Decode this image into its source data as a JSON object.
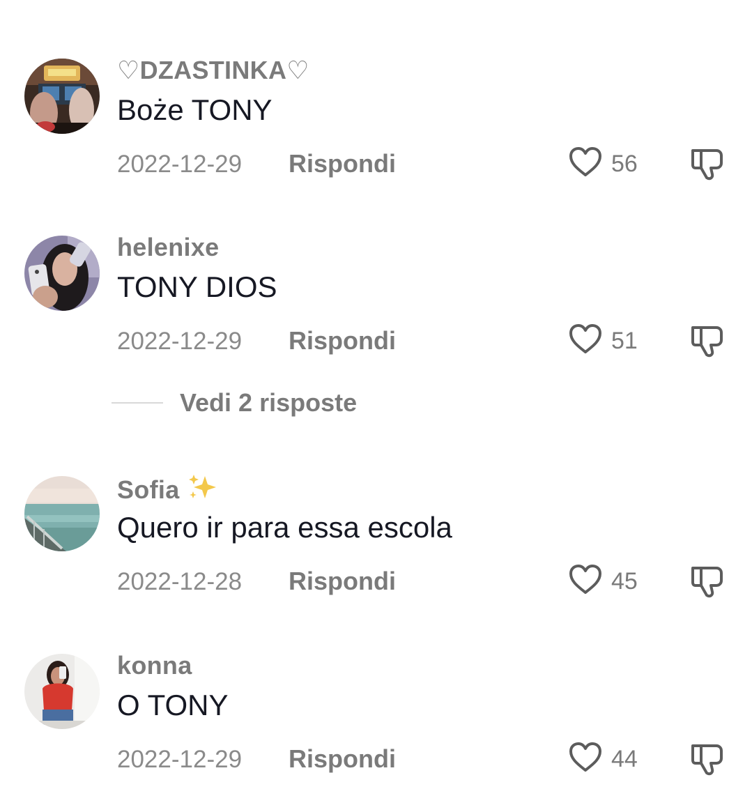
{
  "comments": [
    {
      "username": "♡DZASTINKA♡",
      "text": "Boże TONY",
      "date": "2022-12-29",
      "reply_label": "Rispondi",
      "likes": "56",
      "avatar": "arcade-photo"
    },
    {
      "username": "helenixe",
      "text": "TONY DIOS",
      "date": "2022-12-29",
      "reply_label": "Rispondi",
      "likes": "51",
      "avatar": "selfie-photo"
    },
    {
      "username": "Sofia",
      "username_emoji": "sparkles-icon",
      "text": "Quero ir para essa escola",
      "date": "2022-12-28",
      "reply_label": "Rispondi",
      "likes": "45",
      "avatar": "sea-view-photo"
    },
    {
      "username": "konna",
      "text": "O TONY",
      "date": "2022-12-29",
      "reply_label": "Rispondi",
      "likes": "44",
      "avatar": "mirror-selfie-photo"
    }
  ],
  "view_replies": {
    "label": "Vedi 2 risposte"
  },
  "icons": {
    "like": "heart-outline-icon",
    "dislike": "thumbs-down-icon"
  },
  "colors": {
    "secondary_text": "#7a7a7a",
    "primary_text": "#161823",
    "icon": "#5c5c5c"
  }
}
